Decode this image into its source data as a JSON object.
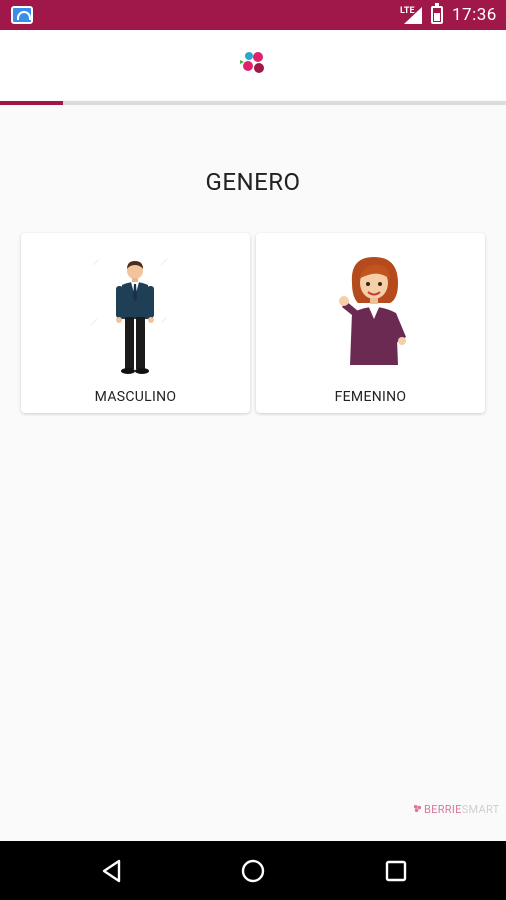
{
  "status_bar": {
    "time": "17:36",
    "network": "LTE",
    "icons": [
      "app-notification-icon",
      "signal-icon",
      "battery-icon"
    ]
  },
  "progress": {
    "fraction": 0.125
  },
  "screen": {
    "title": "GENERO"
  },
  "options": [
    {
      "label": "MASCULINO",
      "image": "man-avatar-icon"
    },
    {
      "label": "FEMENINO",
      "image": "woman-avatar-icon"
    }
  ],
  "brand": {
    "pre": "BERRIE",
    "post": "SMART"
  },
  "navigation": {
    "icons": [
      "back-icon",
      "home-icon",
      "recents-icon"
    ]
  },
  "colors": {
    "accent": "#a0184a",
    "logo_pink": "#e0216e",
    "logo_blue": "#2aa7c9"
  }
}
